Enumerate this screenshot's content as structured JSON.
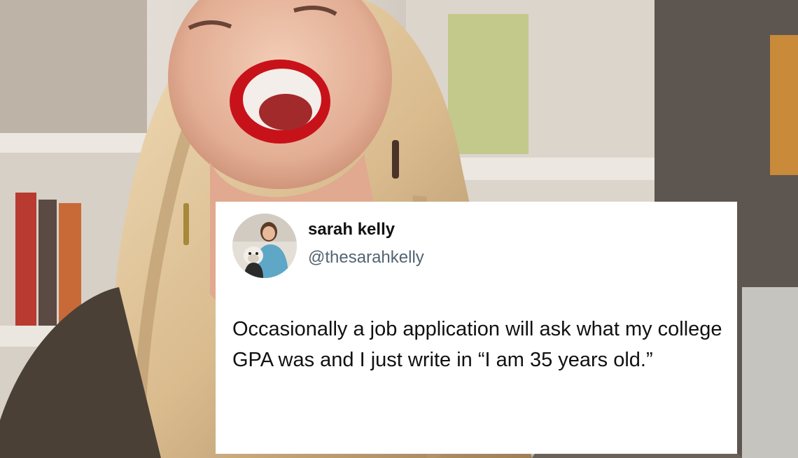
{
  "tweet": {
    "display_name": "sarah kelly",
    "handle": "@thesarahkelly",
    "text": "Occasionally a job application will ask what my college GPA was and I just write in “I am 35 years old.”"
  },
  "icons": {
    "avatar": "avatar-photo"
  },
  "colors": {
    "card_background": "#ffffff",
    "name_text": "#111111",
    "handle_text": "#536471",
    "lipstick": "#c8121a"
  }
}
